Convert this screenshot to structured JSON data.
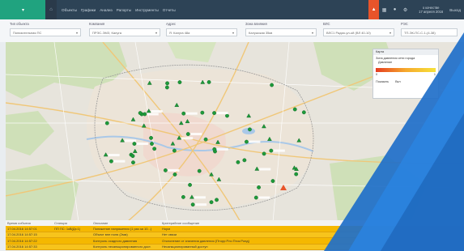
{
  "topbar": {
    "menu": [
      "Объекты",
      "Графики",
      "Анализ",
      "Рапорты",
      "Инструменты",
      "Отчеты"
    ],
    "date_line1": "о качестве",
    "date_line2": "17 апреля 2016",
    "exit_label": "Выход"
  },
  "filters": [
    {
      "label": "Тип объекта",
      "value": "Понизительная ПС"
    },
    {
      "label": "Компания",
      "value": "ПРЭС-ЭМЗ, Калуга"
    },
    {
      "label": "Адрес",
      "value": "Я. Калуга 48а"
    },
    {
      "label": "Зона влияния",
      "value": "Калужская 35кв"
    },
    {
      "label": "ВЛС",
      "value": "ВЛС1 Радио-ул-ой (ВЛ 40-10)"
    },
    {
      "label": "РЭС",
      "value": "ТП-ЭК-ПС-С-1-(4-38)"
    }
  ],
  "legend": {
    "title": "Карта",
    "heading": "Зона давления сети города",
    "pressure_label": "Давление",
    "scale_min": "0",
    "scale_max": "1",
    "show_label": "Показать",
    "toggle_label": "Вкл"
  },
  "events": {
    "headers": [
      "Время события",
      "Станция",
      "Описание",
      "Критерийное сообщение"
    ],
    "rows": [
      [
        "17.04.2016 14:57:01",
        "ПП ПС: 1кВ(Дз:1)",
        "Понижение напряжения (1 раз за 10...)",
        "Норм"
      ],
      [
        "17.04.2016 14:57:15",
        "",
        "Объект вне поля (2мм)",
        "Нет связи"
      ],
      [
        "17.04.2016 14:57:22",
        "",
        "Контроль осадного давления",
        "Отклонение от значения давления (Пторр:Рлс:Пток:Ронд)"
      ],
      [
        "17.04.2016 14:57:33",
        "",
        "Контроль несанкционированного дост.",
        "Несанкционированный доступ"
      ]
    ]
  },
  "map": {
    "green_marker_count": 70,
    "alarm_marker": "warning"
  },
  "colors": {
    "topbar": "#2d4356",
    "logo": "#20a37f",
    "alert": "#e8542a",
    "event_row": "#f5b800",
    "overlay": "#1f6fc9"
  }
}
